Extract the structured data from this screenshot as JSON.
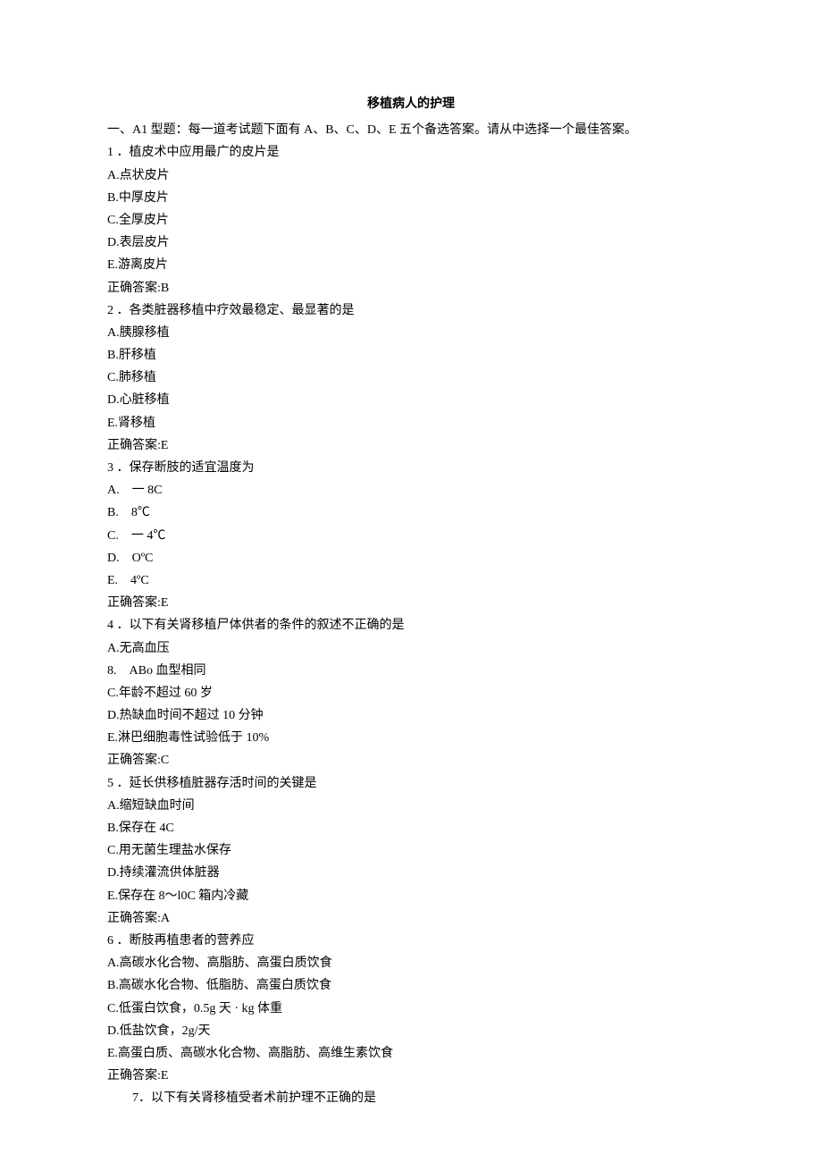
{
  "title": "移植病人的护理",
  "instruction": "一、A1 型题：每一道考试题下面有 A、B、C、D、E 五个备选答案。请从中选择一个最佳答案。",
  "questions": [
    {
      "num": "1",
      "stem": "．植皮术中应用最广的皮片是",
      "options": [
        "A.点状皮片",
        "B.中厚皮片",
        "C.全厚皮片",
        "D.表层皮片",
        "E.游离皮片"
      ],
      "answer": "正确答案:B"
    },
    {
      "num": "2",
      "stem": "．各类脏器移植中疗效最稳定、最显著的是",
      "options": [
        "A.胰腺移植",
        "B.肝移植",
        "C.肺移植",
        "D.心脏移植",
        "E.肾移植"
      ],
      "answer": "正确答案:E"
    },
    {
      "num": "3",
      "stem": "．保存断肢的适宜温度为",
      "options": [
        "A.　一 8C",
        "B.　8℃",
        "C.　一 4℃",
        "D.　OºC",
        "E.　4ºC"
      ],
      "answer": "正确答案:E"
    },
    {
      "num": "4",
      "stem": "．以下有关肾移植尸体供者的条件的叙述不正确的是",
      "options": [
        "A.无高血压",
        "8.　ABo 血型相同",
        "C.年龄不超过 60 岁",
        "D.热缺血时间不超过 10 分钟",
        "E.淋巴细胞毒性试验低于 10%"
      ],
      "answer": "正确答案:C"
    },
    {
      "num": "5",
      "stem": "．延长供移植脏器存活时间的关键是",
      "options": [
        "A.缩短缺血时间",
        "B.保存在 4C",
        "C.用无菌生理盐水保存",
        "D.持续灌流供体脏器",
        "E.保存在 8～l0C 箱内冷藏"
      ],
      "answer": "正确答案:A"
    },
    {
      "num": "6",
      "stem": "．断肢再植患者的营养应",
      "options": [
        "A.高碳水化合物、高脂肪、高蛋白质饮食",
        "B.高碳水化合物、低脂肪、高蛋白质饮食",
        "C.低蛋白饮食，0.5g 天 · kg 体重",
        "D.低盐饮食，2g/天",
        "E.高蛋白质、高碳水化合物、高脂肪、高维生素饮食"
      ],
      "answer": "正确答案:E"
    }
  ],
  "last_line": {
    "num": "7",
    "stem": "．以下有关肾移植受者术前护理不正确的是"
  }
}
